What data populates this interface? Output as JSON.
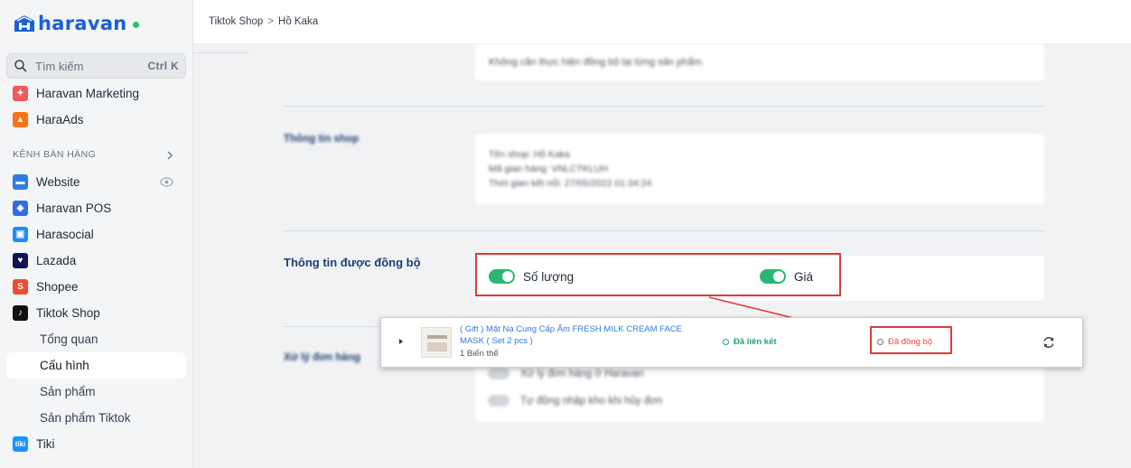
{
  "brand": {
    "name": "haravan"
  },
  "search": {
    "placeholder": "Tìm kiếm",
    "shortcut": "Ctrl K"
  },
  "sidebar": {
    "top_items": [
      {
        "label": "Haravan Marketing"
      },
      {
        "label": "HaraAds"
      }
    ],
    "section_label": "KÊNH BÁN HÀNG",
    "channels": [
      {
        "label": "Website"
      },
      {
        "label": "Haravan POS"
      },
      {
        "label": "Harasocial"
      },
      {
        "label": "Lazada"
      },
      {
        "label": "Shopee"
      },
      {
        "label": "Tiktok Shop"
      }
    ],
    "tiktok_sub": [
      {
        "label": "Tổng quan"
      },
      {
        "label": "Cấu hình"
      },
      {
        "label": "Sản phẩm"
      },
      {
        "label": "Sản phẩm Tiktok"
      }
    ],
    "after": [
      {
        "label": "Tiki"
      }
    ]
  },
  "breadcrumb": {
    "parent": "Tiktok Shop",
    "separator": ">",
    "current": "Hồ Kaka"
  },
  "settings": {
    "top_note": "Không cần thực hiện đồng bộ lại từng sản phẩm.",
    "shop_info_title": "Thông tin shop",
    "shop_name": "Tên shop: Hồ Kaka",
    "shop_id": "Mã gian hàng: VNLCTKLUH",
    "connected_time": "Thời gian kết nối: 27/05/2022 01:34:24",
    "sync_title": "Thông tin được đồng bộ",
    "sync_quantity_label": "Số lượng",
    "sync_price_label": "Giá",
    "order_title": "Xử lý đơn hàng",
    "order_option_1": "Xử lý đơn hàng ở Haravan",
    "order_option_2": "Tự động nhập kho khi hủy đơn"
  },
  "product": {
    "name": "( Gift ) Mặt Nạ Cung Cấp Ẩm FRESH MILK CREAM FACE MASK ( Set 2 pcs )",
    "variants": "1 Biến thể",
    "link_status": "Đã liên kết",
    "sync_status": "Đã đồng bộ"
  },
  "colors": {
    "accent": "#2bb673",
    "link": "#2f7de1",
    "highlight": "#e03a3a",
    "title": "#1f3d73"
  }
}
